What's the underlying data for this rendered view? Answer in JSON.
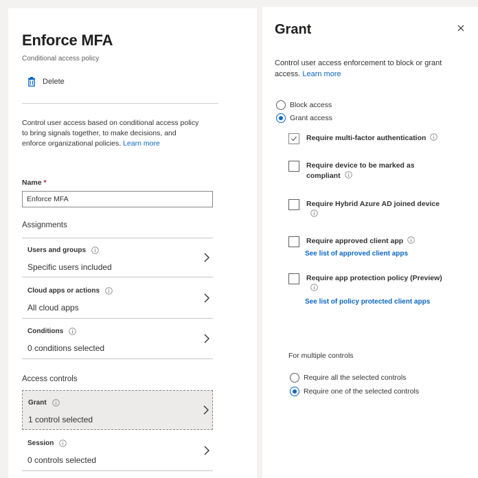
{
  "left": {
    "title": "Enforce MFA",
    "subtitle": "Conditional access policy",
    "delete_label": "Delete",
    "description": "Control user access based on conditional access policy to bring signals together, to make decisions, and enforce organizational policies.",
    "learn_more": "Learn more",
    "name_label": "Name",
    "required_mark": "*",
    "name_value": "Enforce MFA",
    "assignments_title": "Assignments",
    "access_controls_title": "Access controls",
    "rows": [
      {
        "label": "Users and groups",
        "value": "Specific users included"
      },
      {
        "label": "Cloud apps or actions",
        "value": "All cloud apps"
      },
      {
        "label": "Conditions",
        "value": "0 conditions selected"
      },
      {
        "label": "Grant",
        "value": "1 control selected"
      },
      {
        "label": "Session",
        "value": "0 controls selected"
      }
    ]
  },
  "grant": {
    "title": "Grant",
    "close_icon": "close-icon",
    "description": "Control user access enforcement to block or grant access.",
    "learn_more": "Learn more",
    "block_access": "Block access",
    "grant_access": "Grant access",
    "selected_access": "grant_access",
    "controls": [
      {
        "label": "Require multi-factor authentication",
        "checked": true,
        "link": ""
      },
      {
        "label": "Require device to be marked as compliant",
        "checked": false,
        "link": ""
      },
      {
        "label": "Require Hybrid Azure AD joined device",
        "checked": false,
        "link": ""
      },
      {
        "label": "Require approved client app",
        "checked": false,
        "link": "See list of approved client apps"
      },
      {
        "label": "Require app protection policy (Preview)",
        "checked": false,
        "link": "See list of policy protected client apps"
      }
    ],
    "multiple_controls_label": "For multiple controls",
    "require_all": "Require all the selected controls",
    "require_one": "Require one of the selected controls",
    "selected_multi": "require_one"
  },
  "colors": {
    "accent": "#0a66c2",
    "required": "#a4262c",
    "selected_row": "#edebe9"
  }
}
